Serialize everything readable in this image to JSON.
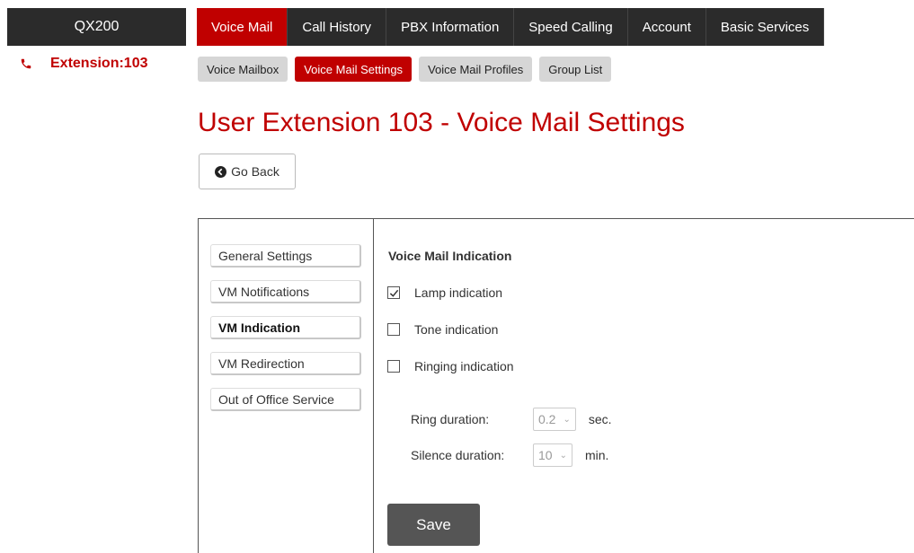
{
  "product": {
    "name": "QX200"
  },
  "topnav": {
    "tabs": [
      {
        "label": "Voice Mail"
      },
      {
        "label": "Call History"
      },
      {
        "label": "PBX Information"
      },
      {
        "label": "Speed Calling"
      },
      {
        "label": "Account"
      },
      {
        "label": "Basic Services"
      }
    ]
  },
  "extension": {
    "label": "Extension:103"
  },
  "subnav": {
    "tabs": [
      {
        "label": "Voice Mailbox"
      },
      {
        "label": "Voice Mail Settings"
      },
      {
        "label": "Voice Mail Profiles"
      },
      {
        "label": "Group List"
      }
    ]
  },
  "page": {
    "title": "User Extension 103 - Voice Mail Settings"
  },
  "go_back": {
    "label": "Go Back"
  },
  "side_tabs": [
    {
      "label": "General Settings"
    },
    {
      "label": "VM Notifications"
    },
    {
      "label": "VM Indication"
    },
    {
      "label": "VM Redirection"
    },
    {
      "label": "Out of Office Service"
    }
  ],
  "section": {
    "heading": "Voice Mail Indication",
    "options": [
      {
        "label": "Lamp indication",
        "checked": true
      },
      {
        "label": "Tone indication",
        "checked": false
      },
      {
        "label": "Ringing indication",
        "checked": false
      }
    ],
    "ring_duration": {
      "label": "Ring duration:",
      "value": "0.2",
      "unit": "sec."
    },
    "silence_duration": {
      "label": "Silence duration:",
      "value": "10",
      "unit": "min."
    }
  },
  "save": {
    "label": "Save"
  },
  "colors": {
    "accent": "#c00000",
    "nav_dark": "#2b2b2b",
    "button_dark": "#555555"
  }
}
